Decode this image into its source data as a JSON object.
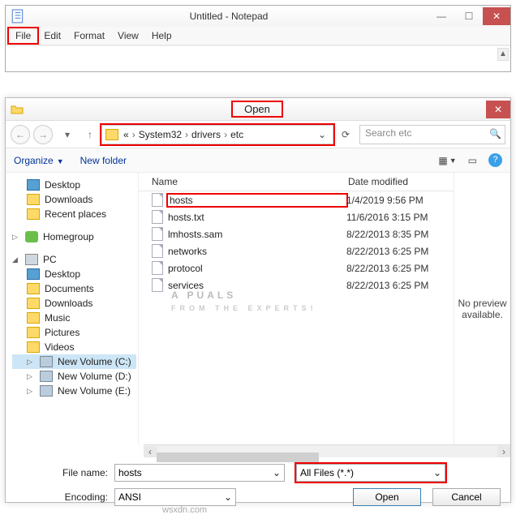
{
  "notepad": {
    "title": "Untitled - Notepad",
    "menu": {
      "file": "File",
      "edit": "Edit",
      "format": "Format",
      "view": "View",
      "help": "Help"
    }
  },
  "dialog": {
    "title": "Open",
    "breadcrumbs": {
      "p0": "«",
      "p1": "System32",
      "p2": "drivers",
      "p3": "etc"
    },
    "search_placeholder": "Search etc",
    "toolbar": {
      "organize": "Organize",
      "newfolder": "New folder"
    },
    "tree": {
      "desktop": "Desktop",
      "downloads": "Downloads",
      "recent": "Recent places",
      "homegroup": "Homegroup",
      "pc": "PC",
      "pc_desktop": "Desktop",
      "pc_documents": "Documents",
      "pc_downloads": "Downloads",
      "pc_music": "Music",
      "pc_pictures": "Pictures",
      "pc_videos": "Videos",
      "drive_c": "New Volume (C:)",
      "drive_d": "New Volume (D:)",
      "drive_e": "New Volume (E:)"
    },
    "columns": {
      "name": "Name",
      "date": "Date modified"
    },
    "files": [
      {
        "name": "hosts",
        "date": "1/4/2019 9:56 PM"
      },
      {
        "name": "hosts.txt",
        "date": "11/6/2016 3:15 PM"
      },
      {
        "name": "lmhosts.sam",
        "date": "8/22/2013 8:35 PM"
      },
      {
        "name": "networks",
        "date": "8/22/2013 6:25 PM"
      },
      {
        "name": "protocol",
        "date": "8/22/2013 6:25 PM"
      },
      {
        "name": "services",
        "date": "8/22/2013 6:25 PM"
      }
    ],
    "preview": "No preview available.",
    "labels": {
      "filename": "File name:",
      "encoding": "Encoding:"
    },
    "filename_value": "hosts",
    "filetype_value": "All Files  (*.*)",
    "encoding_value": "ANSI",
    "buttons": {
      "open": "Open",
      "cancel": "Cancel"
    }
  },
  "watermark": {
    "main": "A   PUALS",
    "sub": "FROM  THE  EXPERTS!"
  },
  "source": "wsxdn.com"
}
